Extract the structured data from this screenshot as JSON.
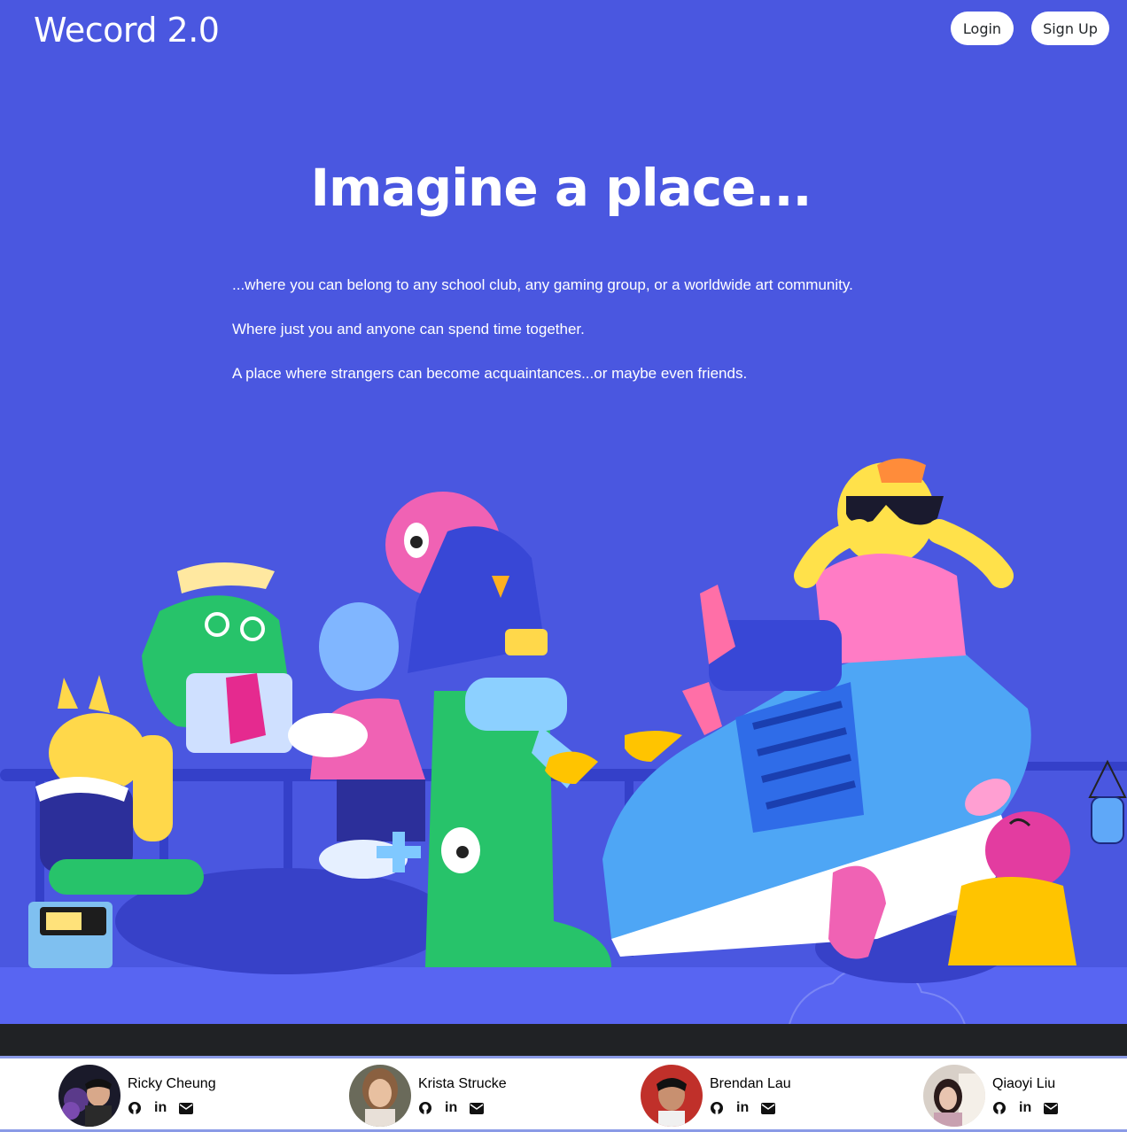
{
  "nav": {
    "logo": "Wecord 2.0",
    "login_label": "Login",
    "signup_label": "Sign Up"
  },
  "hero": {
    "title": "Imagine a place...",
    "lines": [
      "...where you can belong to any school club, any gaming group, or a worldwide art community.",
      "Where just you and anyone can spend time together.",
      "A place where strangers can become acquaintances...or maybe even friends."
    ]
  },
  "team": [
    {
      "name": "Ricky Cheung",
      "icons": [
        "github-icon",
        "linkedin-icon",
        "email-icon"
      ]
    },
    {
      "name": "Krista Strucke",
      "icons": [
        "github-icon",
        "linkedin-icon",
        "email-icon"
      ]
    },
    {
      "name": "Brendan Lau",
      "icons": [
        "github-icon",
        "linkedin-icon",
        "email-icon"
      ]
    },
    {
      "name": "Qiaoyi Liu",
      "icons": [
        "github-icon",
        "linkedin-icon",
        "email-icon"
      ]
    }
  ],
  "linkedin_glyph": "in",
  "colors": {
    "background": "#4a57e0",
    "footer_band": "#202225",
    "footer_border": "#8a9ae6"
  }
}
